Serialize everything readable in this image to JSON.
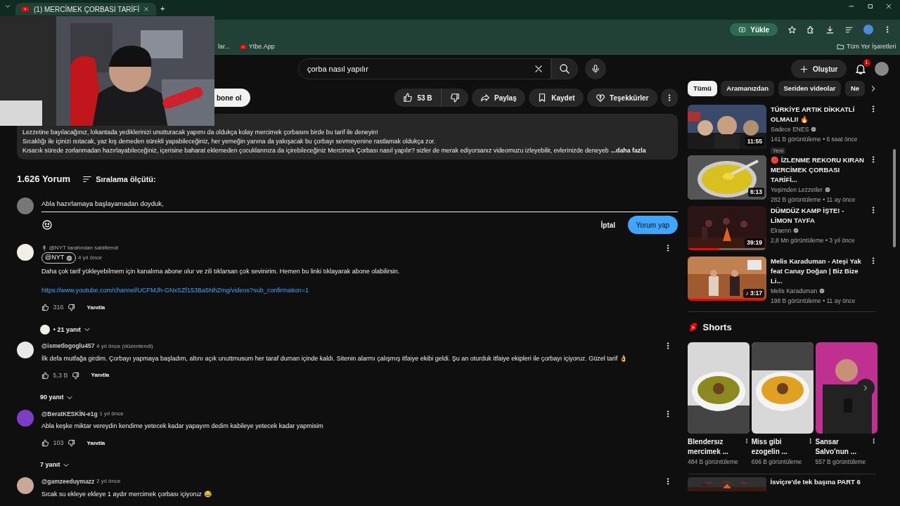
{
  "browser": {
    "tab_title": "(1) MERCİMEK ÇORBASI TARİFİ",
    "new_tab": "+",
    "upload_button": "Yükle",
    "bookmarks": [
      "lar...",
      "Ytbe.App"
    ],
    "all_bookmarks": "Tüm Yer İşaretleri"
  },
  "header": {
    "search_value": "çorba nasıl yapılır",
    "create": "Oluştur",
    "notification_count": "1"
  },
  "actions": {
    "subscribe": "bone ol",
    "likes": "53 B",
    "share": "Paylaş",
    "save": "Kaydet",
    "thanks": "Teşekkürler"
  },
  "description": {
    "lines": [
      "Lezzetine bayılacağınız, lokantada yediklerinizi unutturacak yapımı da oldukça kolay mercimek çorbasını birde bu tarif ile deneyin!",
      "Sıcaklığı ile içinizi ısıtacak, yaz kış demeden sürekli yapabileceğiniz, her yemeğin yanına da yakışacak bu çorbayı sevmeyenine rastlamak oldukça zor.",
      "Kısacık sürede zorlanmadan hazırlayabileceğiniz, içerisine baharat eklemeden çocuklarınıza da içirebileceğiniz Mercimek Çorbası nasıl yapılır? sizler de merak ediyorsanız videomuzu izleyebilir, evlerinizde deneyeb"
    ],
    "more": "...daha fazla"
  },
  "comments_header": {
    "count": "1.626 Yorum",
    "sort": "Sıralama ölçütü:"
  },
  "comment_box": {
    "value": "Abla hazırlamaya başlayamadan doyduk,",
    "cancel": "İptal",
    "submit": "Yorum yap"
  },
  "comments": [
    {
      "pinned_by": "@NYT tarafından sabitlendi",
      "author": "@NYT",
      "owner": true,
      "time": "4 yıl önce",
      "text": "Daha çok tarif yükleyebilmem için kanalıma abone olur ve zili tıklarsan çok sevinirim. Hemen bu linki tıklayarak abone olabilirsin.",
      "link": "https://www.youtube.com/channel/UCFMJh-GNxSZf153Ba5NhZmg/videos?sub_confirmation=1",
      "likes": "316",
      "reply": "Yanıtla",
      "replies": "• 21 yanıt",
      "reply_avatar": true,
      "color": "#f4efe6"
    },
    {
      "author": "@ismetlogoglu457",
      "owner": false,
      "time": "4 yıl önce (düzenlendi)",
      "text": "İlk defa mutfağa girdim. Çorbayı yapmaya başladım, altını açık unuttmusum her taraf duman içinde kaldı. Sitenin alarmı çalışmış itfaiye ekibi geldi. Şu an oturduk itfaiye ekipleri ile  çorbayı içiyoruz. Güzel tarif 👌",
      "likes": "5,3 B",
      "reply": "Yanıtla",
      "replies": "90 yanıt",
      "reply_avatar": false,
      "color": "#e8e8e8"
    },
    {
      "author": "@BeratKESKİN-e1g",
      "owner": false,
      "time": "1 yıl önce",
      "text": "Abla keşke miktar vereydin kendime yetecek kadar yapayım dedim kabileye yetecek kadar yapmisim",
      "likes": "103",
      "reply": "Yanıtla",
      "replies": "7 yanıt",
      "reply_avatar": false,
      "color": "#7b3fc4"
    },
    {
      "author": "@gamzeeduymazz",
      "owner": false,
      "time": "2 yıl önce",
      "text": "Sıcak su ekleye ekleye 1 aydır mercimek çorbası içiyoruz 😂",
      "color": "#c9a89a"
    }
  ],
  "chips": [
    {
      "label": "Tümü",
      "selected": true
    },
    {
      "label": "Aramanızdan",
      "selected": false
    },
    {
      "label": "Seriden videolar",
      "selected": false
    },
    {
      "label": "Ne",
      "selected": false
    }
  ],
  "videos": [
    {
      "title": "TÜRKİYE ARTIK DİKKATLİ OLMALI! 🔥",
      "channel": "Sadece ENES",
      "verified": true,
      "meta": "141 B görüntüleme • 6 saat önce",
      "badge": "Yeni",
      "duration": "11:55",
      "color": "#3a4a6a"
    },
    {
      "title": "🔴 İZLENME REKORU KIRAN MERCİMEK ÇORBASI TARİFİ...",
      "channel": "Yeşimden Lezzetler",
      "verified": true,
      "meta": "282 B görüntüleme • 11 ay önce",
      "duration": "6:13",
      "color": "#d8c020"
    },
    {
      "title": "DÜMDÜZ KAMP İŞTE!  - LİMON TAYFA",
      "channel": "Elraenn",
      "verified": true,
      "meta": "2,8 Mn görüntüleme • 3 yıl önce",
      "duration": "39:19",
      "level": 0.4,
      "color": "#2a1414"
    },
    {
      "title": "Melis Karaduman - Ateşi Yak feat Canay Doğan | Biz Bize Li...",
      "channel": "Melis Karaduman",
      "verified": true,
      "meta": "198 B görüntüleme • 11 ay önce",
      "duration": "♪ 3:17",
      "level": 1,
      "color": "#a05a30"
    }
  ],
  "shorts": {
    "title": "Shorts",
    "items": [
      {
        "title": "Blendersız mercimek ...",
        "views": "484 B görüntüleme",
        "color": "#8a8a20"
      },
      {
        "title": "Miss gibi ezogelin ...",
        "views": "696 B görüntüleme",
        "color": "#e0a020"
      },
      {
        "title": "Sansar Salvo'nun ...",
        "views": "557 B görüntüleme",
        "color": "#c03090"
      }
    ]
  },
  "next_video": {
    "title": "İsviçre'de tek başına PART 6"
  }
}
